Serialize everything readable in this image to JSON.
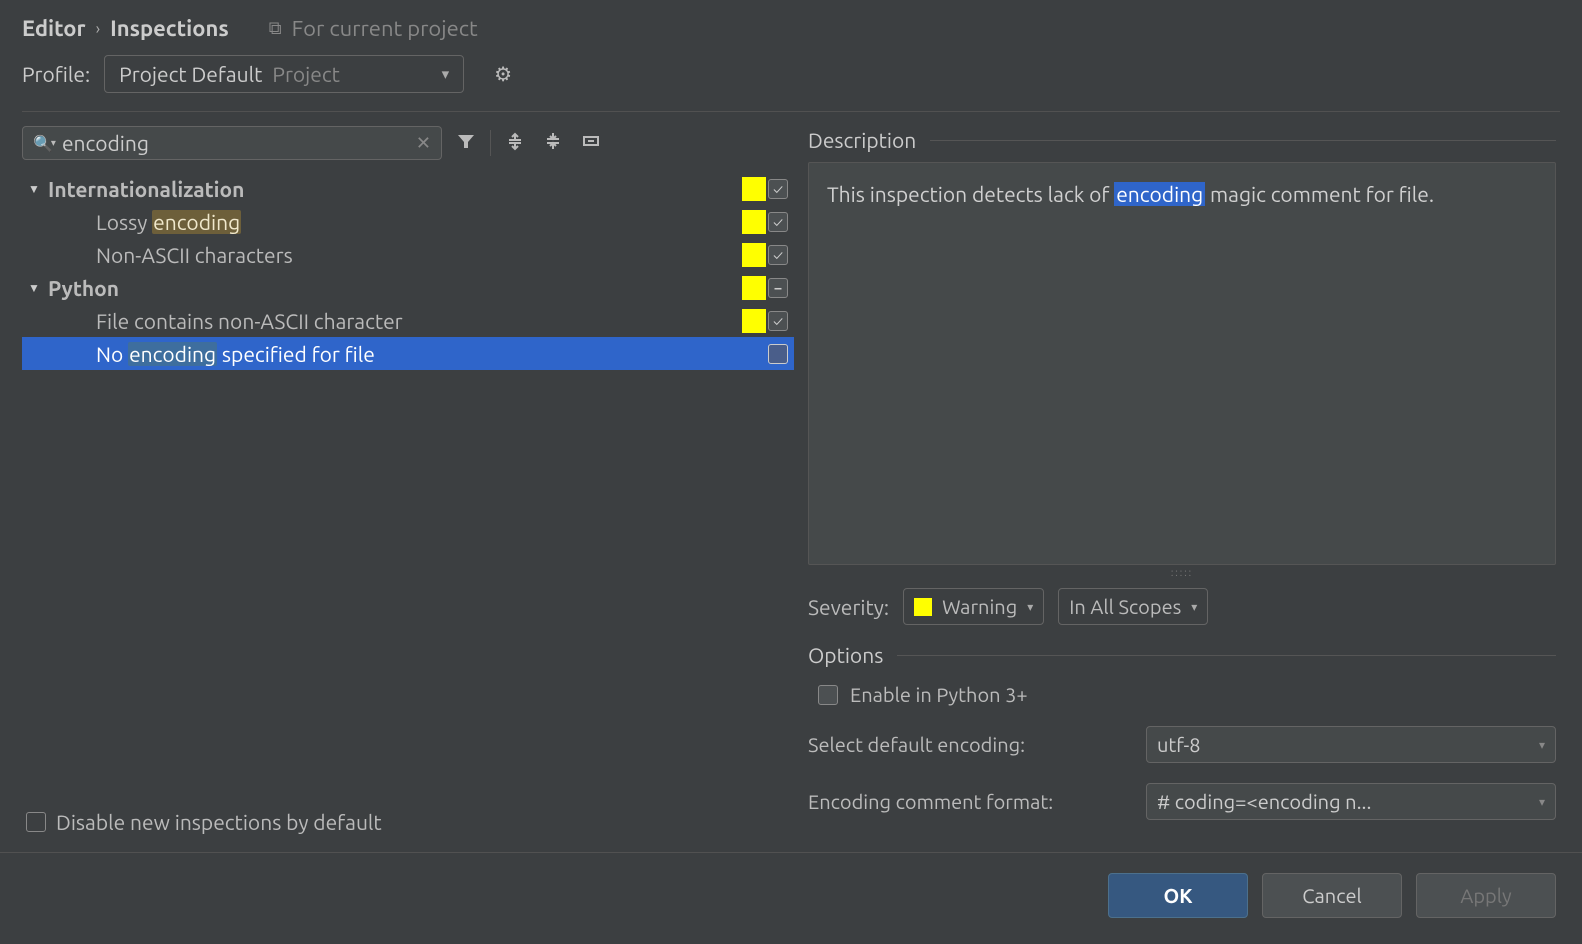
{
  "breadcrumb": {
    "parent": "Editor",
    "current": "Inspections",
    "scope_text": "For current project"
  },
  "profile": {
    "label": "Profile:",
    "name": "Project Default",
    "scope": "Project"
  },
  "search": {
    "value": "encoding"
  },
  "tree": [
    {
      "type": "group",
      "label": "Internationalization",
      "swatch": true,
      "check": "checked"
    },
    {
      "type": "item",
      "label_pre": "Lossy ",
      "label_hl": "encoding",
      "label_post": "",
      "swatch": true,
      "check": "checked"
    },
    {
      "type": "item",
      "label_pre": "Non-ASCII characters",
      "label_hl": "",
      "label_post": "",
      "swatch": true,
      "check": "checked"
    },
    {
      "type": "group",
      "label": "Python",
      "swatch": true,
      "check": "inter"
    },
    {
      "type": "item",
      "label_pre": "File contains non-ASCII character",
      "label_hl": "",
      "label_post": "",
      "swatch": true,
      "check": "checked"
    },
    {
      "type": "item",
      "selected": true,
      "label_pre": "No ",
      "label_hl": "encoding",
      "label_post": " specified for file",
      "swatch": false,
      "check": ""
    }
  ],
  "disable_label": "Disable new inspections by default",
  "description": {
    "header": "Description",
    "text_pre": "This inspection detects lack of ",
    "text_hl": "encoding",
    "text_post": " magic comment for file."
  },
  "severity": {
    "label": "Severity:",
    "value": "Warning",
    "scope": "In All Scopes"
  },
  "options": {
    "header": "Options",
    "enable_py3": "Enable in Python 3+",
    "default_encoding_label": "Select default encoding:",
    "default_encoding_value": "utf-8",
    "comment_format_label": "Encoding comment format:",
    "comment_format_value": "# coding=<encoding n..."
  },
  "buttons": {
    "ok": "OK",
    "cancel": "Cancel",
    "apply": "Apply"
  }
}
